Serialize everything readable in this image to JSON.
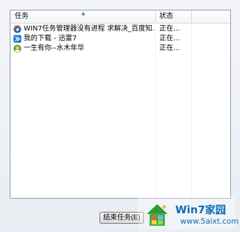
{
  "columns": {
    "task": "任务",
    "status": "状态"
  },
  "tasks": [
    {
      "icon": "ie-icon",
      "name": "WIN7任务管理器没有进程 求解决_百度知...",
      "status": "正在..."
    },
    {
      "icon": "xunlei-icon",
      "name": "我的下载 - 迅雷7",
      "status": "正在..."
    },
    {
      "icon": "qq-icon",
      "name": "一生有你--水木年华",
      "status": "正在..."
    }
  ],
  "buttons": {
    "end_task": "结束任务(E)"
  },
  "watermark": {
    "title": "Win7家园",
    "url": "www.5aixt.com"
  }
}
